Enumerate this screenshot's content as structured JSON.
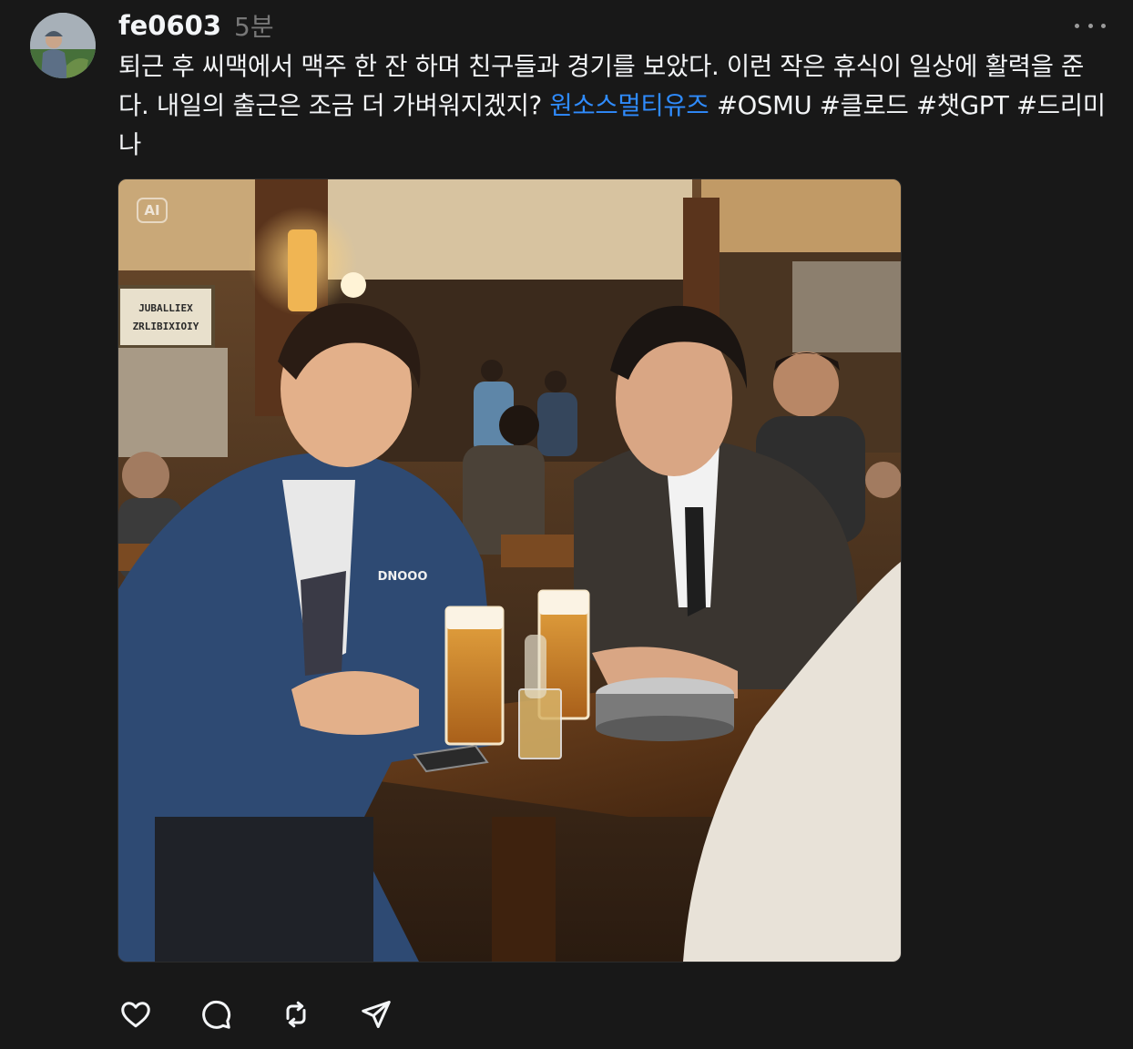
{
  "post": {
    "username": "fe0603",
    "timestamp": "5분",
    "caption_text": "퇴근 후 씨맥에서 맥주 한 잔 하며 친구들과 경기를 보았다. 이런 작은 휴식이 일상에 활력을 준다. 내일의 출근은 조금 더 가벼워지겠지? ",
    "mention_link": "원소스멀티유즈",
    "hashtags": [
      " #OSMU",
      " #클로드",
      " #챗GPT",
      " #드리미나"
    ],
    "media": {
      "badge": "AI",
      "jacket_print": "DNOOO",
      "sign_line_1": "JUBALLIEX",
      "sign_line_2": "ZRLIBIXIOIY"
    }
  },
  "icons": {
    "like": "heart-icon",
    "comment": "comment-icon",
    "repost": "repost-icon",
    "share": "send-icon",
    "more": "more-icon"
  },
  "colors": {
    "background": "#181818",
    "text": "#f3f5f7",
    "muted": "#777777",
    "link": "#2f8cff"
  }
}
